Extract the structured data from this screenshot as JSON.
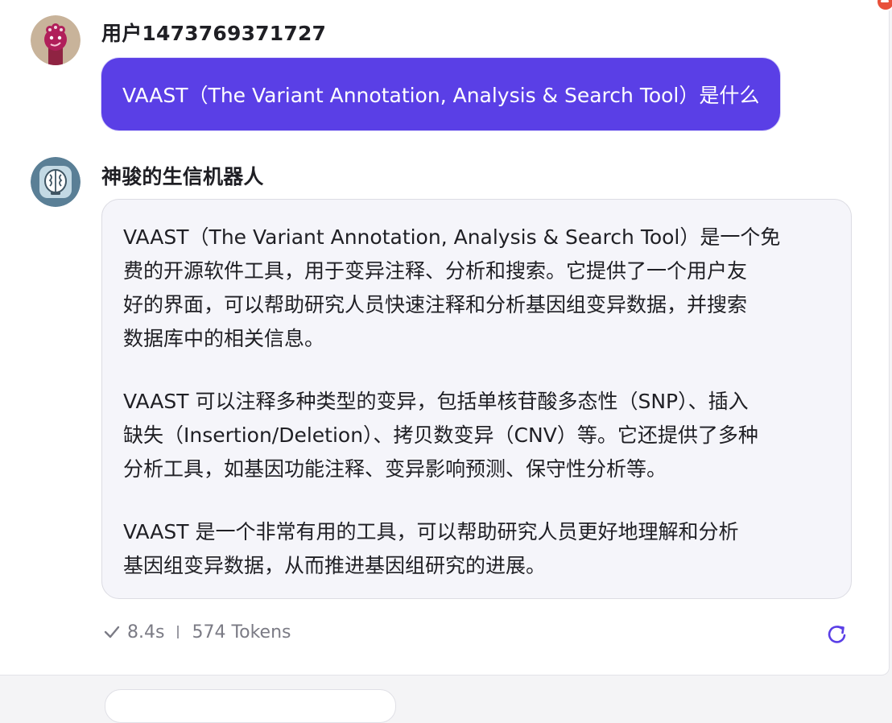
{
  "user_message": {
    "username": "用户1473769371727",
    "text": "VAAST（The Variant Annotation, Analysis & Search Tool）是什么"
  },
  "bot_message": {
    "botname": "神骏的生信机器人",
    "paragraphs": [
      "VAAST（The Variant Annotation, Analysis & Search Tool）是一个免\n费的开源软件工具，用于变异注释、分析和搜索。它提供了一个用户友\n好的界面，可以帮助研究人员快速注释和分析基因组变异数据，并搜索\n数据库中的相关信息。",
      "VAAST 可以注释多种类型的变异，包括单核苷酸多态性（SNP）、插入\n缺失（Insertion/Deletion）、拷贝数变异（CNV）等。它还提供了多种\n分析工具，如基因功能注释、变异影响预测、保守性分析等。",
      "VAAST 是一个非常有用的工具，可以帮助研究人员更好地理解和分析\n基因组变异数据，从而推进基因组研究的进展。"
    ]
  },
  "meta": {
    "duration": "8.4s",
    "tokens": "574 Tokens"
  },
  "icons": {
    "user_avatar": "cartoon-avatar-icon",
    "bot_avatar": "brain-robot-icon",
    "status": "check-icon",
    "regenerate": "refresh-icon",
    "badge": "minus-badge-icon"
  },
  "colors": {
    "accent": "#5a3fe6",
    "bubble_bg": "#f5f5fa",
    "meta_text": "#7b7b85"
  }
}
